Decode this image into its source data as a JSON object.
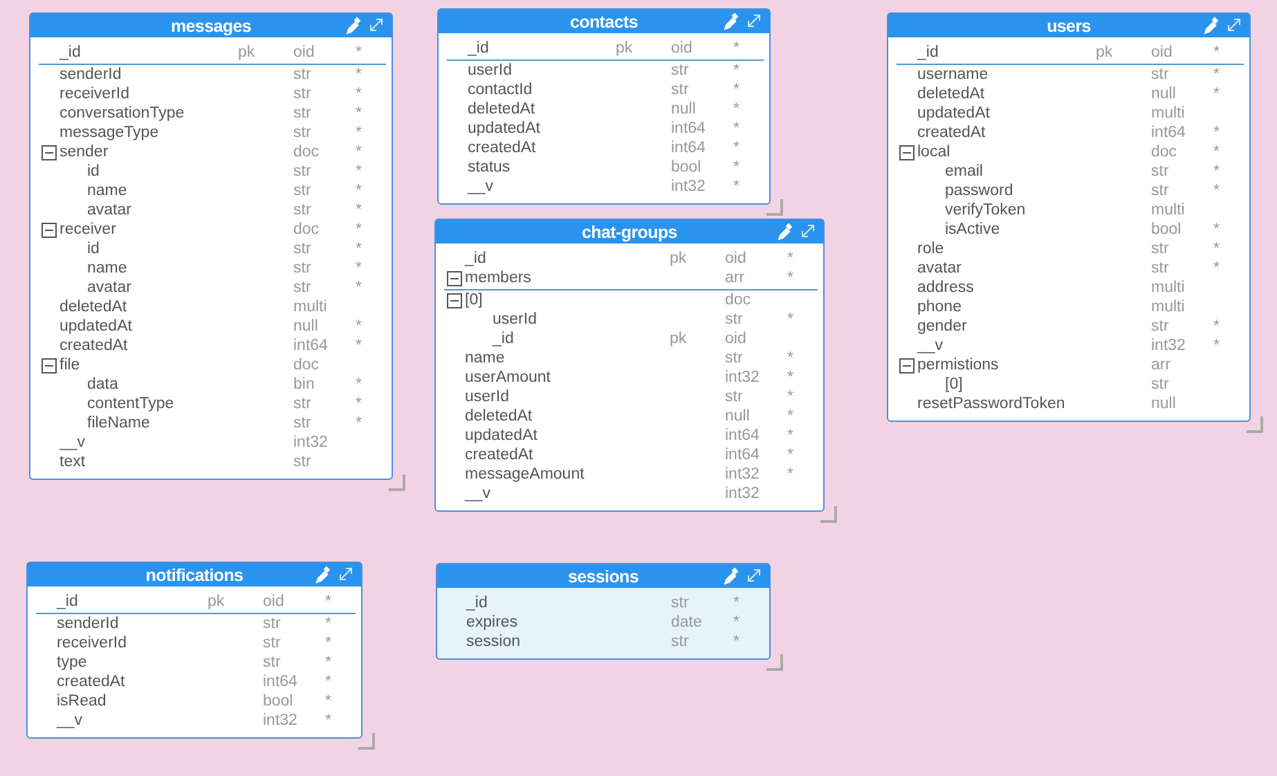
{
  "tables": [
    {
      "name": "messages",
      "selected": false,
      "key_fields": [
        {
          "name": "_id",
          "key": "pk",
          "type": "oid",
          "flag": "*"
        }
      ],
      "fields": [
        {
          "name": "senderId",
          "type": "str",
          "flag": "*"
        },
        {
          "name": "receiverId",
          "type": "str",
          "flag": "*"
        },
        {
          "name": "conversationType",
          "type": "str",
          "flag": "*"
        },
        {
          "name": "messageType",
          "type": "str",
          "flag": "*"
        },
        {
          "name": "sender",
          "type": "doc",
          "flag": "*",
          "expanded": true,
          "children": [
            {
              "name": "id",
              "type": "str",
              "flag": "*"
            },
            {
              "name": "name",
              "type": "str",
              "flag": "*"
            },
            {
              "name": "avatar",
              "type": "str",
              "flag": "*"
            }
          ]
        },
        {
          "name": "receiver",
          "type": "doc",
          "flag": "*",
          "expanded": true,
          "children": [
            {
              "name": "id",
              "type": "str",
              "flag": "*"
            },
            {
              "name": "name",
              "type": "str",
              "flag": "*"
            },
            {
              "name": "avatar",
              "type": "str",
              "flag": "*"
            }
          ]
        },
        {
          "name": "deletedAt",
          "type": "multi"
        },
        {
          "name": "updatedAt",
          "type": "null",
          "flag": "*"
        },
        {
          "name": "createdAt",
          "type": "int64",
          "flag": "*"
        },
        {
          "name": "file",
          "type": "doc",
          "expanded": true,
          "children": [
            {
              "name": "data",
              "type": "bin",
              "flag": "*"
            },
            {
              "name": "contentType",
              "type": "str",
              "flag": "*"
            },
            {
              "name": "fileName",
              "type": "str",
              "flag": "*"
            }
          ]
        },
        {
          "name": "__v",
          "type": "int32"
        },
        {
          "name": "text",
          "type": "str"
        }
      ]
    },
    {
      "name": "contacts",
      "selected": false,
      "key_fields": [
        {
          "name": "_id",
          "key": "pk",
          "type": "oid",
          "flag": "*"
        }
      ],
      "fields": [
        {
          "name": "userId",
          "type": "str",
          "flag": "*"
        },
        {
          "name": "contactId",
          "type": "str",
          "flag": "*"
        },
        {
          "name": "deletedAt",
          "type": "null",
          "flag": "*"
        },
        {
          "name": "updatedAt",
          "type": "int64",
          "flag": "*"
        },
        {
          "name": "createdAt",
          "type": "int64",
          "flag": "*"
        },
        {
          "name": "status",
          "type": "bool",
          "flag": "*"
        },
        {
          "name": "__v",
          "type": "int32",
          "flag": "*"
        }
      ]
    },
    {
      "name": "chat-groups",
      "selected": false,
      "key_fields": [
        {
          "name": "_id",
          "key": "pk",
          "type": "oid",
          "flag": "*"
        },
        {
          "name": "members",
          "type": "arr",
          "flag": "*",
          "expanded": true
        }
      ],
      "fields": [
        {
          "name": "[0]",
          "type": "doc",
          "expanded": true,
          "children": [
            {
              "name": "userId",
              "type": "str",
              "flag": "*"
            },
            {
              "name": "_id",
              "key": "pk",
              "type": "oid"
            }
          ]
        },
        {
          "name": "name",
          "type": "str",
          "flag": "*"
        },
        {
          "name": "userAmount",
          "type": "int32",
          "flag": "*"
        },
        {
          "name": "userId",
          "type": "str",
          "flag": "*"
        },
        {
          "name": "deletedAt",
          "type": "null",
          "flag": "*"
        },
        {
          "name": "updatedAt",
          "type": "int64",
          "flag": "*"
        },
        {
          "name": "createdAt",
          "type": "int64",
          "flag": "*"
        },
        {
          "name": "messageAmount",
          "type": "int32",
          "flag": "*"
        },
        {
          "name": "__v",
          "type": "int32"
        }
      ]
    },
    {
      "name": "users",
      "selected": false,
      "key_fields": [
        {
          "name": "_id",
          "key": "pk",
          "type": "oid",
          "flag": "*"
        }
      ],
      "fields": [
        {
          "name": "username",
          "type": "str",
          "flag": "*"
        },
        {
          "name": "deletedAt",
          "type": "null",
          "flag": "*"
        },
        {
          "name": "updatedAt",
          "type": "multi"
        },
        {
          "name": "createdAt",
          "type": "int64",
          "flag": "*"
        },
        {
          "name": "local",
          "type": "doc",
          "flag": "*",
          "expanded": true,
          "children": [
            {
              "name": "email",
              "type": "str",
              "flag": "*"
            },
            {
              "name": "password",
              "type": "str",
              "flag": "*"
            },
            {
              "name": "verifyToken",
              "type": "multi"
            },
            {
              "name": "isActive",
              "type": "bool",
              "flag": "*"
            }
          ]
        },
        {
          "name": "role",
          "type": "str",
          "flag": "*"
        },
        {
          "name": "avatar",
          "type": "str",
          "flag": "*"
        },
        {
          "name": "address",
          "type": "multi"
        },
        {
          "name": "phone",
          "type": "multi"
        },
        {
          "name": "gender",
          "type": "str",
          "flag": "*"
        },
        {
          "name": "__v",
          "type": "int32",
          "flag": "*"
        },
        {
          "name": "permistions",
          "type": "arr",
          "expanded": true,
          "children": [
            {
              "name": "[0]",
              "type": "str"
            }
          ]
        },
        {
          "name": "resetPasswordToken",
          "type": "null"
        }
      ]
    },
    {
      "name": "notifications",
      "selected": false,
      "key_fields": [
        {
          "name": "_id",
          "key": "pk",
          "type": "oid",
          "flag": "*"
        }
      ],
      "fields": [
        {
          "name": "senderId",
          "type": "str",
          "flag": "*"
        },
        {
          "name": "receiverId",
          "type": "str",
          "flag": "*"
        },
        {
          "name": "type",
          "type": "str",
          "flag": "*"
        },
        {
          "name": "createdAt",
          "type": "int64",
          "flag": "*"
        },
        {
          "name": "isRead",
          "type": "bool",
          "flag": "*"
        },
        {
          "name": "__v",
          "type": "int32",
          "flag": "*"
        }
      ]
    },
    {
      "name": "sessions",
      "selected": true,
      "fields": [
        {
          "name": "_id",
          "type": "str",
          "flag": "*"
        },
        {
          "name": "expires",
          "type": "date",
          "flag": "*"
        },
        {
          "name": "session",
          "type": "str",
          "flag": "*"
        }
      ]
    }
  ]
}
